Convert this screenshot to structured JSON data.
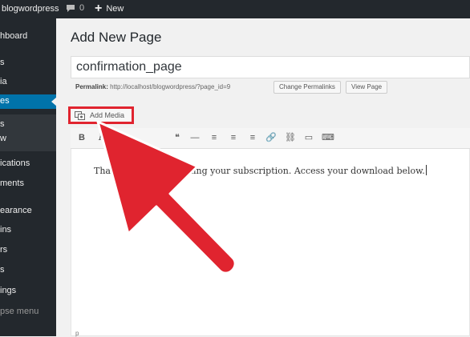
{
  "adminbar": {
    "site_name": "blogwordpress",
    "comment_count": "0",
    "new_label": "New"
  },
  "sidebar": {
    "items": [
      {
        "label": "hboard"
      },
      {
        "label": "s"
      },
      {
        "label": "ia"
      },
      {
        "label": "es"
      },
      {
        "label": "s"
      },
      {
        "label": "w"
      },
      {
        "label": "ications"
      },
      {
        "label": "ments"
      },
      {
        "label": "earance"
      },
      {
        "label": "ins"
      },
      {
        "label": "rs"
      },
      {
        "label": "s"
      },
      {
        "label": "ings"
      },
      {
        "label": "pse menu"
      }
    ]
  },
  "page": {
    "title": "Add New Page",
    "post_title": "confirmation_page",
    "permalink_label": "Permalink:",
    "permalink_url": "http://localhost/blogwordpress/?page_id=9",
    "change_permalinks": "Change Permalinks",
    "view_page": "View Page",
    "add_media": "Add Media"
  },
  "editor": {
    "toolbar": [
      "B",
      "I",
      "❝",
      "—",
      "≡",
      "≡",
      "≡",
      "🔗",
      "⛓",
      "▭",
      "⌨"
    ],
    "content": "Thank you for confirming your subscription. Access your download below.",
    "path": "p"
  },
  "colors": {
    "admin_dark": "#23282d",
    "active_blue": "#0073aa",
    "highlight_red": "#e0242f"
  }
}
